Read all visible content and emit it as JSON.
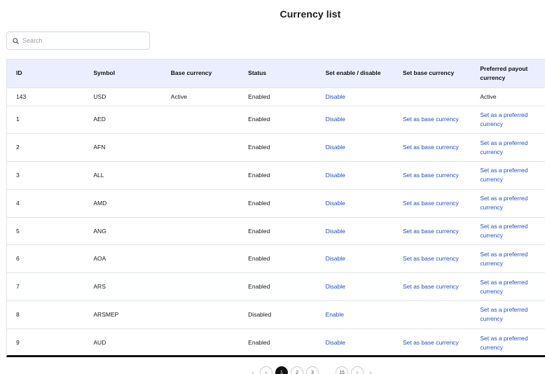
{
  "page": {
    "title": "Currency list"
  },
  "search": {
    "placeholder": "Search",
    "value": ""
  },
  "table": {
    "columns": [
      "ID",
      "Symbol",
      "Base currency",
      "Status",
      "Set enable / disable",
      "Set base currency",
      "Preferred payout currency"
    ],
    "rows": [
      {
        "id": "143",
        "symbol": "USD",
        "base": "Active",
        "status": "Enabled",
        "toggle": "Disable",
        "set_base": "",
        "preferred": "Active",
        "preferred_is_link": false
      },
      {
        "id": "1",
        "symbol": "AED",
        "base": "",
        "status": "Enabled",
        "toggle": "Disable",
        "set_base": "Set as base currency",
        "preferred": "Set as a preferred currency",
        "preferred_is_link": true
      },
      {
        "id": "2",
        "symbol": "AFN",
        "base": "",
        "status": "Enabled",
        "toggle": "Disable",
        "set_base": "Set as base currency",
        "preferred": "Set as a preferred currency",
        "preferred_is_link": true
      },
      {
        "id": "3",
        "symbol": "ALL",
        "base": "",
        "status": "Enabled",
        "toggle": "Disable",
        "set_base": "Set as base currency",
        "preferred": "Set as a preferred currency",
        "preferred_is_link": true
      },
      {
        "id": "4",
        "symbol": "AMD",
        "base": "",
        "status": "Enabled",
        "toggle": "Disable",
        "set_base": "Set as base currency",
        "preferred": "Set as a preferred currency",
        "preferred_is_link": true
      },
      {
        "id": "5",
        "symbol": "ANG",
        "base": "",
        "status": "Enabled",
        "toggle": "Disable",
        "set_base": "Set as base currency",
        "preferred": "Set as a preferred currency",
        "preferred_is_link": true
      },
      {
        "id": "6",
        "symbol": "AOA",
        "base": "",
        "status": "Enabled",
        "toggle": "Disable",
        "set_base": "Set as base currency",
        "preferred": "Set as a preferred currency",
        "preferred_is_link": true
      },
      {
        "id": "7",
        "symbol": "ARS",
        "base": "",
        "status": "Enabled",
        "toggle": "Disable",
        "set_base": "Set as base currency",
        "preferred": "Set as a preferred currency",
        "preferred_is_link": true
      },
      {
        "id": "8",
        "symbol": "ARSMEP",
        "base": "",
        "status": "Disabled",
        "toggle": "Enable",
        "set_base": "",
        "preferred": "Set as a preferred currency",
        "preferred_is_link": true
      },
      {
        "id": "9",
        "symbol": "AUD",
        "base": "",
        "status": "Enabled",
        "toggle": "Disable",
        "set_base": "Set as base currency",
        "preferred": "Set as a preferred currency",
        "preferred_is_link": true
      }
    ]
  },
  "pagination": {
    "pages": [
      "1",
      "2",
      "3",
      "15"
    ],
    "current": "1"
  },
  "colors": {
    "header_bg": "#ebeefe",
    "link": "#1d4fd1",
    "border": "#e2e4e8"
  },
  "icons": {
    "search": "search-icon"
  }
}
